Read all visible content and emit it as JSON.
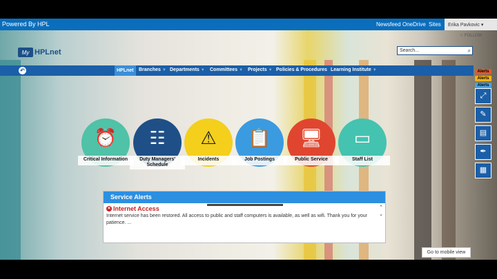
{
  "suitebar": {
    "brand": "Powered By HPL",
    "links": [
      "Newsfeed",
      "OneDrive",
      "Sites"
    ],
    "user": "Erika Pavkovic ▾",
    "follow": "☆ FOLLOW"
  },
  "header": {
    "logo_text": "HPLnet",
    "logo_mark": "My",
    "search_placeholder": "Search..."
  },
  "nav": {
    "items": [
      {
        "label": "HPLnet"
      },
      {
        "label": "Branches",
        "caret": "▼"
      },
      {
        "label": "Departments",
        "caret": "▼"
      },
      {
        "label": "Committees",
        "caret": "▼"
      },
      {
        "label": "Projects",
        "caret": "▼"
      },
      {
        "label": "Policies & Procedures"
      },
      {
        "label": "Learning Institute",
        "caret": "▼"
      }
    ]
  },
  "alert_tabs": [
    {
      "label": "Alerts",
      "color": "#e05a2b"
    },
    {
      "label": "Alerts",
      "color": "#f2b21b"
    },
    {
      "label": "Alerts",
      "color": "#4aa3df"
    }
  ],
  "side_icons": [
    "expand-icon",
    "notes-icon",
    "clipboard-icon",
    "quill-icon",
    "news-icon"
  ],
  "tiles": [
    {
      "label": "Critical Information",
      "color": "#4fc2a7",
      "icon": "alarm-icon"
    },
    {
      "label": "Duty Managers' Schedule",
      "color": "#1f4f87",
      "icon": "schedule-icon"
    },
    {
      "label": "Incidents",
      "color": "#f4cf1c",
      "icon": "warning-icon"
    },
    {
      "label": "Job Postings",
      "color": "#3b9be0",
      "icon": "clipboard-icon"
    },
    {
      "label": "Public Service",
      "color": "#e0462f",
      "icon": "computer-icon"
    },
    {
      "label": "Staff List",
      "color": "#44c3b0",
      "icon": "id-card-icon"
    }
  ],
  "service_alerts": {
    "heading": "Service Alerts",
    "title": "Internet Access",
    "body": "Internet service has been restored. All access to public and staff computers is available, as well as wifi. Thank you for your patience. ..."
  },
  "mobile_button": "Go to mobile view"
}
